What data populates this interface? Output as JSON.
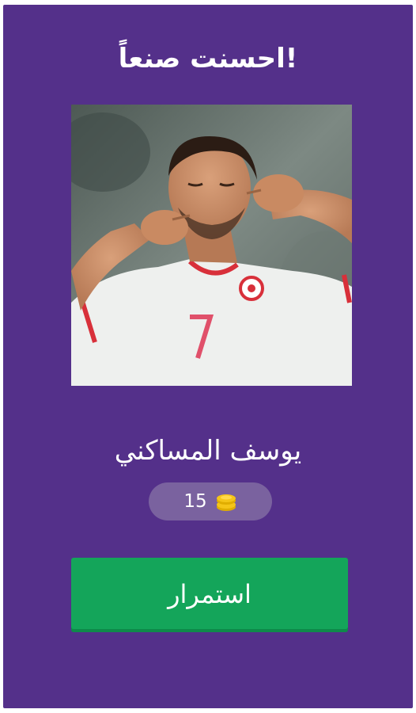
{
  "result": {
    "title": "!احسنت صنعاً",
    "answer_name": "يوسف المساكني"
  },
  "reward": {
    "coins": "15",
    "icon": "coins-stack-icon",
    "coin_color": "#f5c518"
  },
  "actions": {
    "continue_label": "استمرار"
  },
  "colors": {
    "background": "#54308a",
    "pill": "#7a629f",
    "button": "#14a55a"
  }
}
